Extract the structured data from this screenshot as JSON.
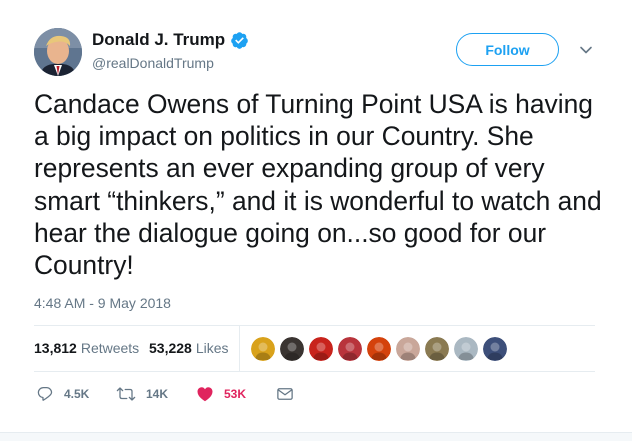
{
  "author": {
    "display_name": "Donald J. Trump",
    "handle": "@realDonaldTrump",
    "verified": true
  },
  "follow_button_label": "Follow",
  "tweet": {
    "text": "Candace Owens of Turning Point USA is having a big impact on politics in our Country. She represents an ever expanding group of very smart “thinkers,” and it is wonderful to watch and hear the dialogue going on...so good for our Country!",
    "timestamp": "4:48 AM - 9 May 2018"
  },
  "stats": {
    "retweets_count": "13,812",
    "retweets_label": "Retweets",
    "likes_count": "53,228",
    "likes_label": "Likes"
  },
  "likers": [
    {
      "color": "#d9a21b"
    },
    {
      "color": "#3a3431"
    },
    {
      "color": "#c8231c"
    },
    {
      "color": "#b8343c"
    },
    {
      "color": "#d4420c"
    },
    {
      "color": "#c9a79a"
    },
    {
      "color": "#8a7a52"
    },
    {
      "color": "#aab8c2"
    },
    {
      "color": "#3d4f7a"
    }
  ],
  "actions": {
    "reply_count": "4.5K",
    "retweet_count": "14K",
    "like_count": "53K"
  },
  "colors": {
    "accent": "#1da1f2",
    "like": "#e0245e",
    "muted": "#657786",
    "text": "#14171a",
    "border": "#e6ecf0"
  }
}
